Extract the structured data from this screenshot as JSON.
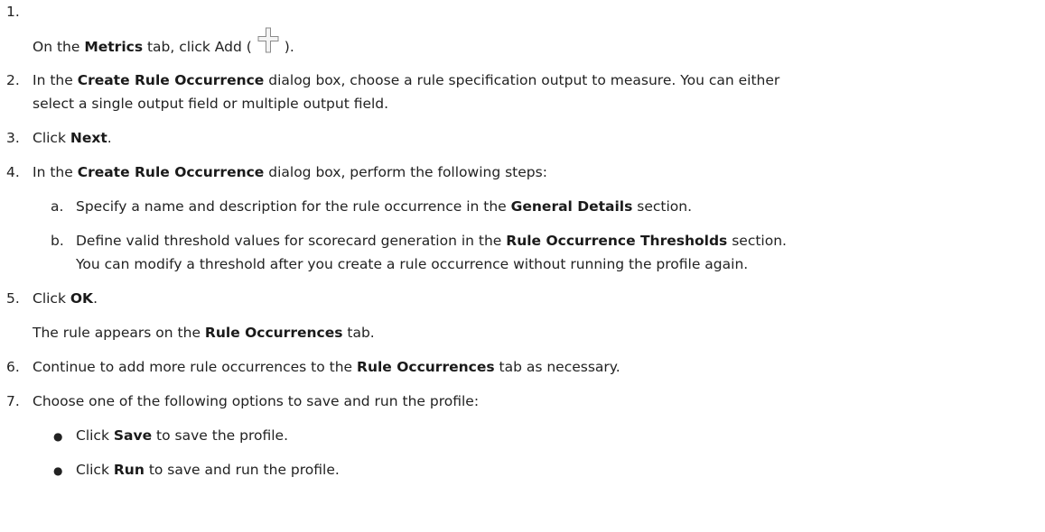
{
  "steps": [
    {
      "num": "1.",
      "pre": "On the ",
      "b1": "Metrics",
      "mid": " tab, click Add (",
      "icon": "plus-icon",
      "post": ")."
    },
    {
      "num": "2.",
      "pre": "In the ",
      "b1": "Create Rule Occurrence",
      "post_line1": " dialog box, choose a rule specification output to measure. You can either",
      "line2": "select a single output field or multiple output field."
    },
    {
      "num": "3.",
      "pre": "Click ",
      "b1": "Next",
      "post": "."
    },
    {
      "num": "4.",
      "pre": "In the ",
      "b1": "Create Rule Occurrence",
      "post": " dialog box, perform the following steps:",
      "substeps": [
        {
          "letter": "a.",
          "pre": "Specify a name and description for the rule occurrence in the ",
          "b1": "General Details",
          "post": " section."
        },
        {
          "letter": "b.",
          "pre": "Define valid threshold values for scorecard generation in the ",
          "b1": "Rule Occurrence Thresholds",
          "post": " section.",
          "line2": "You can modify a threshold after you create a rule occurrence without running the profile again."
        }
      ]
    },
    {
      "num": "5.",
      "pre": "Click ",
      "b1": "OK",
      "post": ".",
      "note_pre": "The rule appears on the ",
      "note_b": "Rule Occurrences",
      "note_post": " tab."
    },
    {
      "num": "6.",
      "pre": "Continue to add more rule occurrences to the ",
      "b1": "Rule Occurrences",
      "post": " tab as necessary."
    },
    {
      "num": "7.",
      "text": "Choose one of the following options to save and run the profile:",
      "bullets": [
        {
          "pre": "Click ",
          "b1": "Save",
          "post": " to save the profile."
        },
        {
          "pre": "Click ",
          "b1": "Run",
          "post": " to save and run the profile."
        }
      ]
    }
  ]
}
